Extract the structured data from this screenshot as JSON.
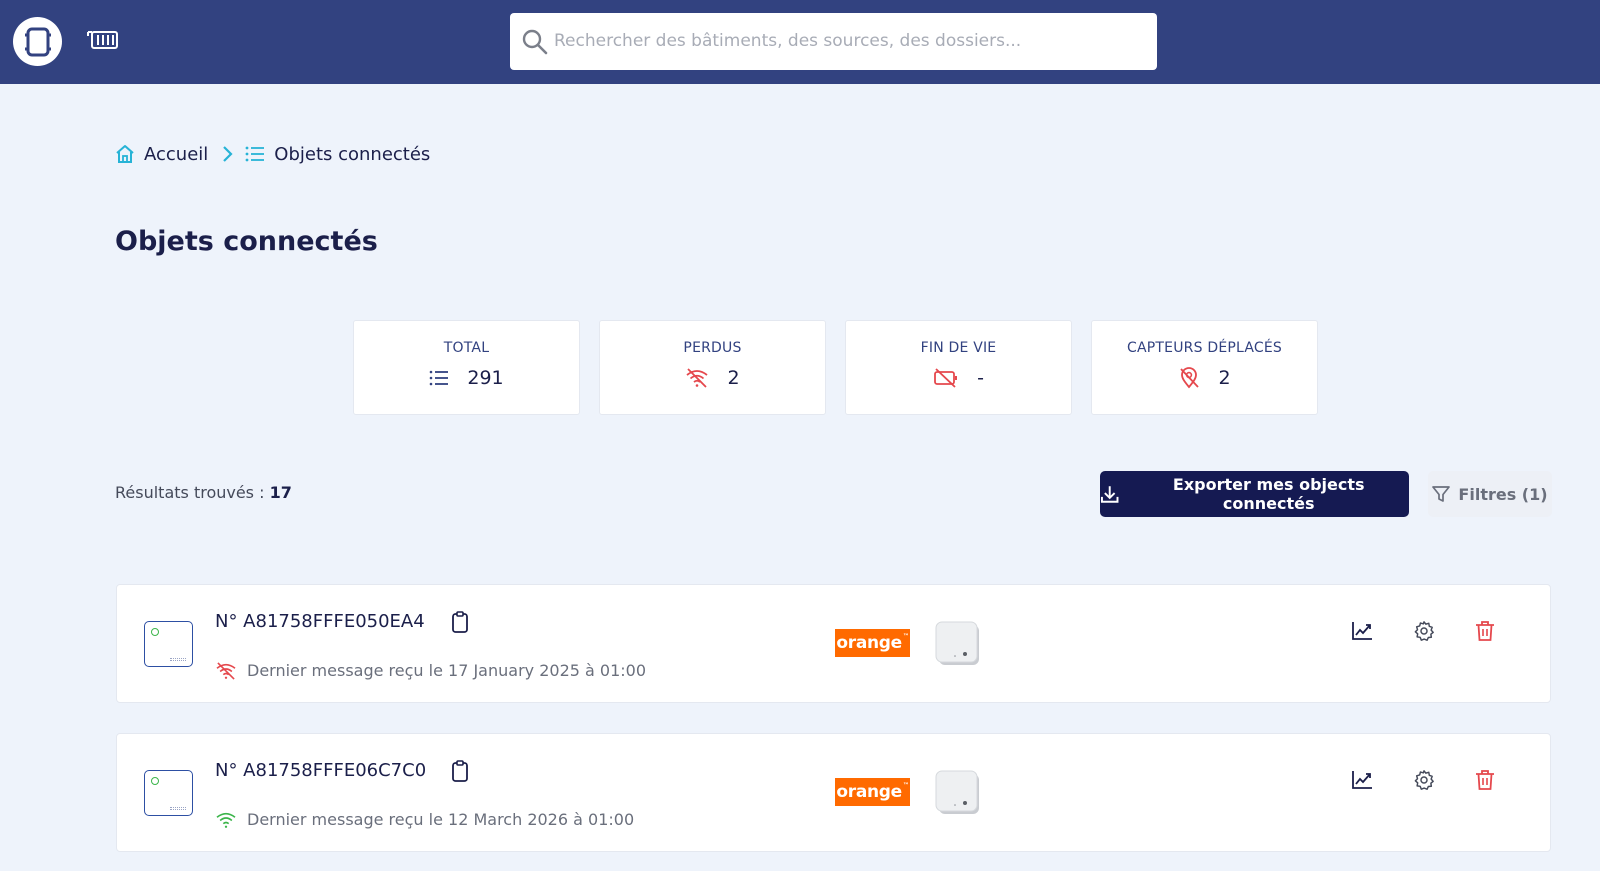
{
  "header": {
    "search": {
      "placeholder": "Rechercher des bâtiments, des sources, des dossiers..."
    }
  },
  "breadcrumb": {
    "home_label": "Accueil",
    "current_label": "Objets connectés"
  },
  "page": {
    "title": "Objets connectés"
  },
  "stats": [
    {
      "label": "TOTAL",
      "value": "291",
      "icon": "list-icon",
      "color": "#324280"
    },
    {
      "label": "PERDUS",
      "value": "2",
      "icon": "wifi-off-icon",
      "color": "#e5484d"
    },
    {
      "label": "FIN DE VIE",
      "value": "-",
      "icon": "battery-off-icon",
      "color": "#e5484d"
    },
    {
      "label": "CAPTEURS DÉPLACÉS",
      "value": "2",
      "icon": "location-off-icon",
      "color": "#e5484d"
    }
  ],
  "results": {
    "label": "Résultats trouvés : ",
    "count": "17"
  },
  "toolbar": {
    "export_label": "Exporter mes objects connectés",
    "filter_label": "Filtres (1)"
  },
  "devices": [
    {
      "serial": "N° A81758FFFE050EA4",
      "status_icon": "wifi-off-icon",
      "status_color": "#e5484d",
      "last_message": "Dernier message reçu le 17 January 2025 à 01:00",
      "operator": "orange",
      "operator_mark": "™"
    },
    {
      "serial": "N° A81758FFFE06C7C0",
      "status_icon": "wifi-icon",
      "status_color": "#3bb54a",
      "last_message": "Dernier message reçu le 12 March 2026 à 01:00",
      "operator": "orange",
      "operator_mark": "™"
    }
  ],
  "colors": {
    "header": "#324280",
    "background": "#eef3fb",
    "primary_button": "#151a52",
    "danger": "#e5484d",
    "success": "#3bb54a",
    "orange_brand": "#ff6a00",
    "accent_cyan": "#27b3d6"
  }
}
